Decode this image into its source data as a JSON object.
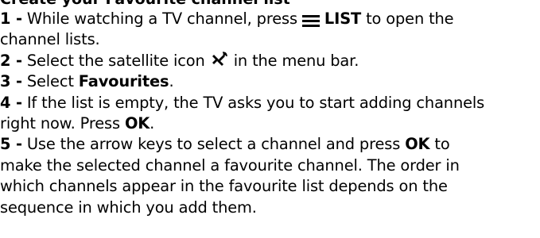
{
  "heading": "Create your Favourite channel list",
  "steps": [
    {
      "num": "1 -",
      "text_a": "While watching a TV channel, press",
      "key": "LIST",
      "text_b": "to open the",
      "line2": "channel lists."
    },
    {
      "num": "2 -",
      "text_a": "Select the satellite icon",
      "text_b": "in the menu bar."
    },
    {
      "num": "3 -",
      "text_a": "Select",
      "bold": "Favourites",
      "text_b": "."
    },
    {
      "num": "4 -",
      "text_a": "If the list is empty, the TV asks you to start adding channels",
      "line2_a": "right now. Press",
      "bold": "OK",
      "line2_b": "."
    },
    {
      "num": "5 -",
      "text_a": "Use the arrow keys to select a channel and press",
      "bold": "OK",
      "text_b": "to",
      "line2": "make the selected channel a favourite channel. The order in",
      "line3": "which channels appear in the favourite list depends on the",
      "line4": "sequence in which you add them."
    }
  ],
  "icons": {
    "list": "menu-lines-icon",
    "satellite": "satellite-icon"
  }
}
